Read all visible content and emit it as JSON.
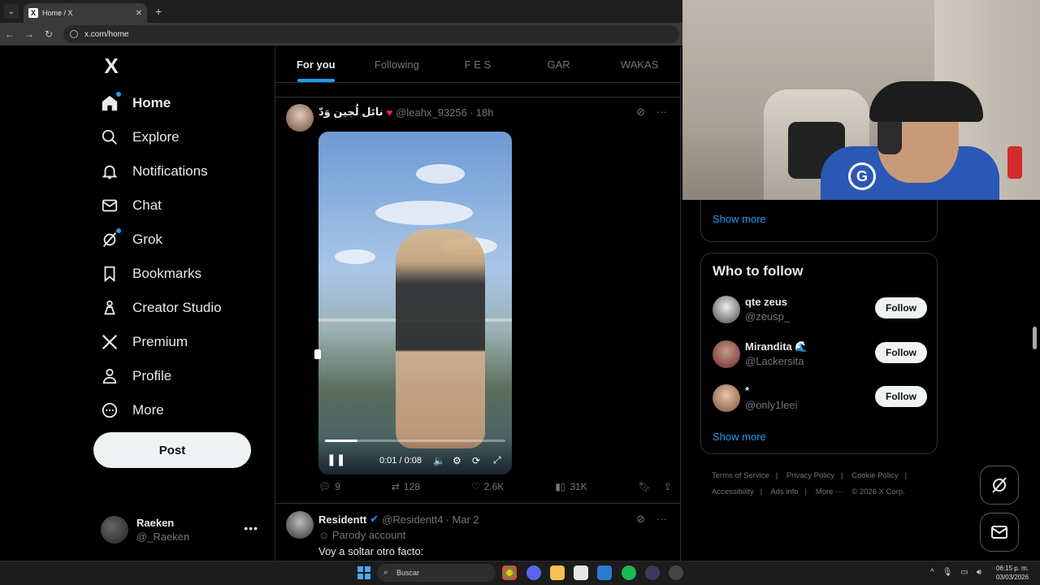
{
  "browser": {
    "tab_title": "Home / X",
    "url": "x.com/home"
  },
  "sidebar": {
    "logo": "X",
    "items": [
      {
        "label": "Home",
        "icon": "home-icon"
      },
      {
        "label": "Explore",
        "icon": "search-icon"
      },
      {
        "label": "Notifications",
        "icon": "bell-icon"
      },
      {
        "label": "Chat",
        "icon": "envelope-icon"
      },
      {
        "label": "Grok",
        "icon": "grok-icon"
      },
      {
        "label": "Bookmarks",
        "icon": "bookmark-icon"
      },
      {
        "label": "Creator Studio",
        "icon": "creator-icon"
      },
      {
        "label": "Premium",
        "icon": "x-premium-icon"
      },
      {
        "label": "Profile",
        "icon": "person-icon"
      },
      {
        "label": "More",
        "icon": "more-circle-icon"
      }
    ],
    "post_label": "Post",
    "account": {
      "name": "Raeken",
      "handle": "@_Raeken"
    }
  },
  "feed": {
    "tabs": [
      "For you",
      "Following",
      "F E S",
      "GAR",
      "WAKAS"
    ],
    "tweets": [
      {
        "name": "نائل لُجين وَدّ",
        "handle": "@leahx_93256",
        "time": "· 18h",
        "video_time": "0:01 / 0:08",
        "video_progress": 0.18,
        "replies": "9",
        "reposts": "128",
        "likes": "2.6K",
        "views": "31K"
      },
      {
        "name": "Residentt",
        "handle": "@Residentt4",
        "time": "· Mar 2",
        "label": "Parody account",
        "text": "Voy a soltar otro facto:"
      }
    ]
  },
  "right": {
    "show_more_top": "Show more",
    "who_to_follow": {
      "title": "Who to follow",
      "users": [
        {
          "name": "qte zeus",
          "handle": "@zeusp_",
          "button": "Follow"
        },
        {
          "name": "Mirandita 🌊",
          "handle": "@Lackersita",
          "button": "Follow"
        },
        {
          "name": "*",
          "handle": "@only1leei",
          "button": "Follow"
        }
      ],
      "show_more": "Show more"
    },
    "footer": [
      "Terms of Service",
      "|",
      "Privacy Policy",
      "|",
      "Cookie Policy",
      "|",
      "Accessibility",
      "|",
      "Ads info",
      "|",
      "More ···",
      "© 2026 X Corp."
    ]
  },
  "taskbar": {
    "search": "Buscar",
    "time": "06:15 p. m.",
    "date": "03/03/2026"
  },
  "colors": {
    "accent": "#1d9bf0",
    "background": "#000000",
    "border": "#2f3336",
    "muted": "#71767b"
  }
}
